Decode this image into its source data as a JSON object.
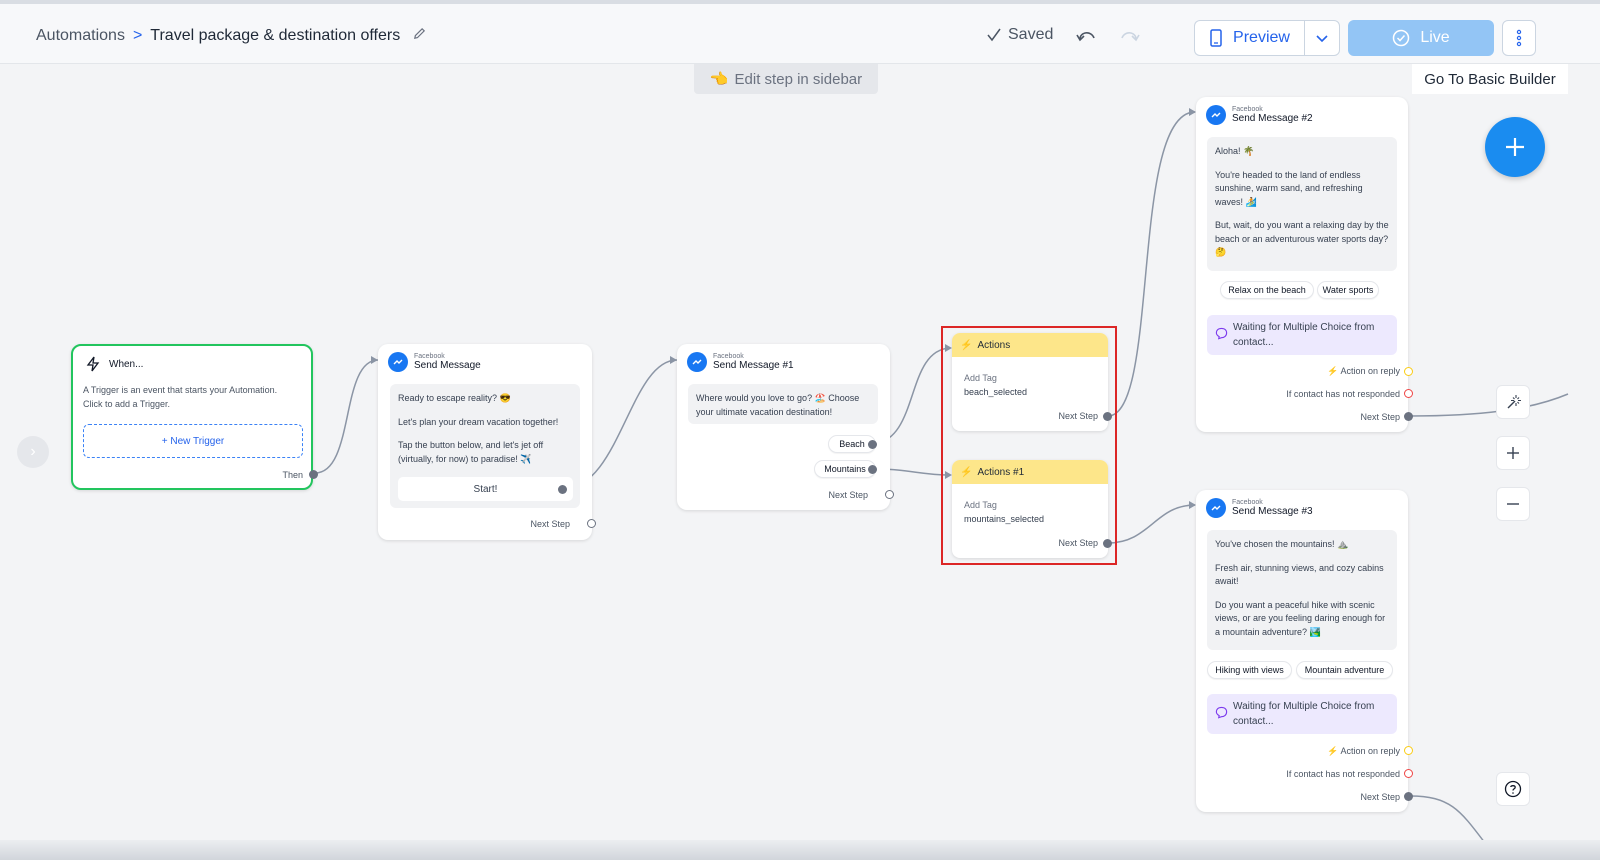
{
  "header": {
    "breadcrumb_root": "Automations",
    "breadcrumb_sep": ">",
    "breadcrumb_current": "Travel package & destination offers",
    "saved_label": "Saved",
    "preview_label": "Preview",
    "live_label": "Live"
  },
  "canvas": {
    "edit_hint": "Edit step in sidebar",
    "basic_builder_label": "Go To Basic Builder"
  },
  "trigger": {
    "title": "When...",
    "description": "A Trigger is an event that starts your Automation. Click to add a Trigger.",
    "new_trigger_label": "+ New Trigger",
    "then_label": "Then"
  },
  "send_message": {
    "platform": "Facebook",
    "title": "Send Message",
    "lines": [
      "Ready to escape reality? 😎",
      "Let's plan your dream vacation together!",
      "Tap the button below, and let's jet off (virtually, for now) to paradise! ✈️"
    ],
    "button_label": "Start!",
    "next_step_label": "Next Step"
  },
  "send_message_1": {
    "platform": "Facebook",
    "title": "Send Message #1",
    "text": "Where would you love to go? 🏖️ Choose your ultimate vacation destination!",
    "options": [
      "Beach",
      "Mountains"
    ],
    "next_step_label": "Next Step"
  },
  "actions": {
    "title": "Actions",
    "label": "Add Tag",
    "value": "beach_selected",
    "next_step_label": "Next Step"
  },
  "actions_1": {
    "title": "Actions #1",
    "label": "Add Tag",
    "value": "mountains_selected",
    "next_step_label": "Next Step"
  },
  "send_message_2": {
    "platform": "Facebook",
    "title": "Send Message #2",
    "lines": [
      "Aloha! 🌴",
      "You're headed to the land of endless sunshine, warm sand, and refreshing waves! 🏄",
      "But, wait, do you want a relaxing day by the beach or an adventurous water sports day? 🤔"
    ],
    "chips": [
      "Relax on the beach",
      "Water sports"
    ],
    "waiting_text": "Waiting for Multiple Choice from contact...",
    "action_on_reply": "Action on reply",
    "not_responded": "If contact has not responded",
    "next_step_label": "Next Step"
  },
  "send_message_3": {
    "platform": "Facebook",
    "title": "Send Message #3",
    "lines": [
      "You've chosen the mountains! ⛰️",
      "Fresh air, stunning views, and cozy cabins await!",
      "Do you want a peaceful hike with scenic views, or are you feeling daring enough for a mountain adventure? 🏞️"
    ],
    "chips": [
      "Hiking with views",
      "Mountain adventure"
    ],
    "waiting_text": "Waiting for Multiple Choice from contact...",
    "action_on_reply": "Action on reply",
    "not_responded": "If contact has not responded",
    "next_step_label": "Next Step"
  },
  "colors": {
    "accent": "#1a8cf0",
    "trigger_border": "#22c55e",
    "action_header": "#fde68a",
    "highlight": "#dc2626",
    "waiting_bg": "#ede9fe"
  }
}
